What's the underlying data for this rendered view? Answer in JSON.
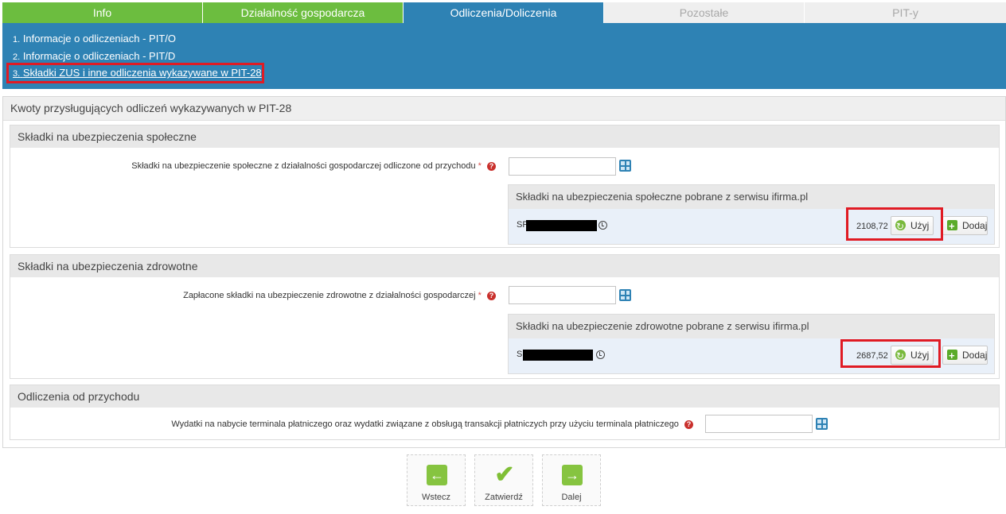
{
  "tabs": [
    {
      "label": "Info"
    },
    {
      "label": "Działalność gospodarcza"
    },
    {
      "label": "Odliczenia/Doliczenia"
    },
    {
      "label": "Pozostałe"
    },
    {
      "label": "PIT-y"
    }
  ],
  "submenu": [
    {
      "num": "1.",
      "label": "Informacje o odliczeniach - PIT/O"
    },
    {
      "num": "2.",
      "label": "Informacje o odliczeniach - PIT/D"
    },
    {
      "num": "3.",
      "label": "Składki ZUS i inne odliczenia wykazywane w PIT-28"
    }
  ],
  "panel": {
    "title": "Kwoty przysługujących odliczeń wykazywanych w PIT-28"
  },
  "social": {
    "title": "Składki na ubezpieczenia społeczne",
    "field_label": "Składki na ubezpieczenie społeczne z działalności gospodarczej odliczone od przychodu",
    "required_mark": "*",
    "input_value": "",
    "box_title": "Składki na ubezpieczenia społeczne pobrane z serwisu ifirma.pl",
    "row_prefix": "SP",
    "amount": "2108,72",
    "use_label": "Użyj",
    "add_label": "Dodaj"
  },
  "health": {
    "title": "Składki na ubezpieczenia zdrowotne",
    "field_label": "Zapłacone składki na ubezpieczenie zdrowotne z działalności gospodarczej",
    "required_mark": "*",
    "input_value": "",
    "box_title": "Składki na ubezpieczenie zdrowotne pobrane z serwisu ifirma.pl",
    "row_prefix": "S",
    "amount": "2687,52",
    "use_label": "Użyj",
    "add_label": "Dodaj"
  },
  "income": {
    "title": "Odliczenia od przychodu",
    "field_label": "Wydatki na nabycie terminala płatniczego oraz wydatki związane z obsługą transakcji płatniczych przy użyciu terminala płatniczego",
    "input_value": ""
  },
  "footer": {
    "back_label": "Wstecz",
    "confirm_label": "Zatwierdź",
    "next_label": "Dalej"
  },
  "colors": {
    "tab_green": "#6cbd3f",
    "tab_active": "#2e82b4",
    "highlight_red": "#e01b24"
  }
}
